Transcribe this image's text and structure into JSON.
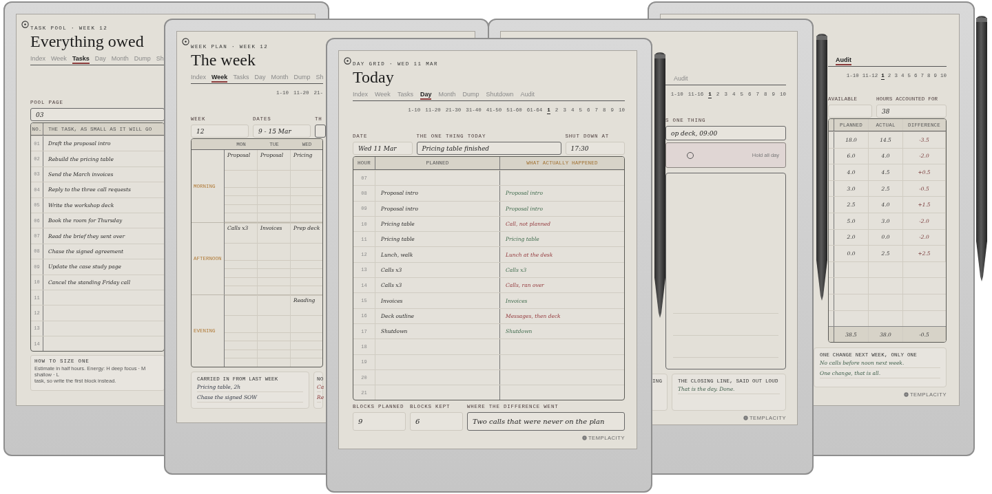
{
  "devices": [
    {
      "kind": "tasks",
      "eyebrow": "TASK POOL · WEEK 12",
      "title": "Everything owed",
      "tabs": [
        {
          "label": "Index",
          "selected": false
        },
        {
          "label": "Week",
          "selected": false
        },
        {
          "label": "Tasks",
          "selected": true
        },
        {
          "label": "Day",
          "selected": false
        },
        {
          "label": "Month",
          "selected": false
        },
        {
          "label": "Dump",
          "selected": false
        },
        {
          "label": "Sh",
          "selected": false
        }
      ],
      "fields": [
        {
          "label": "POOL PAGE",
          "value": "03",
          "highlighted": true
        }
      ],
      "columns": [
        "NO.",
        "THE TASK, AS SMALL AS IT WILL GO"
      ],
      "rows": [
        {
          "no": "01",
          "task": "Draft the proposal intro"
        },
        {
          "no": "02",
          "task": "Rebuild the pricing table"
        },
        {
          "no": "03",
          "task": "Send the March invoices"
        },
        {
          "no": "04",
          "task": "Reply to the three call requests"
        },
        {
          "no": "05",
          "task": "Write the workshop deck"
        },
        {
          "no": "06",
          "task": "Book the room for Thursday"
        },
        {
          "no": "07",
          "task": "Read the brief they sent over"
        },
        {
          "no": "08",
          "task": "Chase the signed agreement"
        },
        {
          "no": "09",
          "task": "Update the case study page"
        },
        {
          "no": "10",
          "task": "Cancel the standing Friday call"
        },
        {
          "no": "11"
        },
        {
          "no": "12"
        },
        {
          "no": "13"
        },
        {
          "no": "14"
        }
      ],
      "note": {
        "title": "HOW TO SIZE ONE",
        "lines": [
          "Estimate in half hours. Energy: H deep focus · M shallow · L",
          "task, so write the first block instead."
        ]
      }
    },
    {
      "kind": "week",
      "eyebrow": "WEEK PLAN · WEEK 12",
      "title": "The week",
      "tabs": [
        {
          "label": "Index",
          "selected": false
        },
        {
          "label": "Week",
          "selected": true
        },
        {
          "label": "Tasks",
          "selected": false
        },
        {
          "label": "Day",
          "selected": false
        },
        {
          "label": "Month",
          "selected": false
        },
        {
          "label": "Dump",
          "selected": false
        },
        {
          "label": "Sh",
          "selected": false
        }
      ],
      "pager": [
        {
          "label": "1-10",
          "selected": false
        },
        {
          "label": "11-20",
          "selected": false
        },
        {
          "label": "21-",
          "selected": false
        }
      ],
      "fields": [
        {
          "label": "WEEK",
          "value": "12",
          "highlighted": false
        },
        {
          "label": "DATES",
          "value": "9 - 15 Mar",
          "highlighted": false
        },
        {
          "label": "TH",
          "highlighted": true
        }
      ],
      "sections": [
        "MORNING",
        "AFTERNOON",
        "EVENING"
      ],
      "columns": [
        {
          "label": "MON",
          "entries": [
            "Proposal",
            "Calls x3"
          ]
        },
        {
          "label": "TUE",
          "entries": [
            "Proposal",
            "Invoices"
          ]
        },
        {
          "label": "WED",
          "entries": [
            "Pricing",
            "Prep deck",
            "Reading"
          ]
        }
      ],
      "boxes": [
        {
          "title": "CARRIED IN FROM LAST WEEK",
          "kind": "dark",
          "lines": [
            "Pricing table, 2h",
            "Chase the signed SOW"
          ]
        },
        {
          "title": "NO",
          "kind": "red",
          "lines": [
            "Ca",
            "Re"
          ]
        }
      ]
    },
    {
      "kind": "day",
      "eyebrow": "DAY GRID · WED 11 MAR",
      "title": "Today",
      "tabs": [
        {
          "label": "Index",
          "selected": false
        },
        {
          "label": "Week",
          "selected": false
        },
        {
          "label": "Tasks",
          "selected": false
        },
        {
          "label": "Day",
          "selected": true
        },
        {
          "label": "Month",
          "selected": false
        },
        {
          "label": "Dump",
          "selected": false
        },
        {
          "label": "Shutdown",
          "selected": false
        },
        {
          "label": "Audit",
          "selected": false
        }
      ],
      "pager": [
        {
          "label": "1-10",
          "selected": false
        },
        {
          "label": "11-20",
          "selected": false
        },
        {
          "label": "21-30",
          "selected": false
        },
        {
          "label": "31-40",
          "selected": false
        },
        {
          "label": "41-50",
          "selected": false
        },
        {
          "label": "51-60",
          "selected": false
        },
        {
          "label": "61-64",
          "selected": false
        },
        {
          "label": "1",
          "selected": true
        },
        {
          "label": "2",
          "selected": false
        },
        {
          "label": "3",
          "selected": false
        },
        {
          "label": "4",
          "selected": false
        },
        {
          "label": "5",
          "selected": false
        },
        {
          "label": "6",
          "selected": false
        },
        {
          "label": "7",
          "selected": false
        },
        {
          "label": "8",
          "selected": false
        },
        {
          "label": "9",
          "selected": false
        },
        {
          "label": "10",
          "selected": false
        }
      ],
      "fields": [
        {
          "label": "DATE",
          "value": "Wed 11 Mar",
          "highlighted": false
        },
        {
          "label": "THE ONE THING TODAY",
          "value": "Pricing table finished",
          "highlighted": true
        },
        {
          "label": "SHUT DOWN AT",
          "value": "17:30",
          "highlighted": false
        }
      ],
      "columns": [
        "HOUR",
        "PLANNED",
        "WHAT ACTUALLY HAPPENED"
      ],
      "rows": [
        {
          "hour": "07"
        },
        {
          "hour": "08",
          "planned": "Proposal intro",
          "actual": "Proposal intro",
          "kept": true
        },
        {
          "hour": "09",
          "planned": "Proposal intro",
          "actual": "Proposal intro",
          "kept": true
        },
        {
          "hour": "10",
          "planned": "Pricing table",
          "actual": "Call, not planned",
          "kept": false
        },
        {
          "hour": "11",
          "planned": "Pricing table",
          "actual": "Pricing table",
          "kept": true
        },
        {
          "hour": "12",
          "planned": "Lunch, walk",
          "actual": "Lunch at the desk",
          "kept": false
        },
        {
          "hour": "13",
          "planned": "Calls x3",
          "actual": "Calls x3",
          "kept": true
        },
        {
          "hour": "14",
          "planned": "Calls x3",
          "actual": "Calls, ran over",
          "kept": false
        },
        {
          "hour": "15",
          "planned": "Invoices",
          "actual": "Invoices",
          "kept": true
        },
        {
          "hour": "16",
          "planned": "Deck outline",
          "actual": "Messages, then deck",
          "kept": false
        },
        {
          "hour": "17",
          "planned": "Shutdown",
          "actual": "Shutdown",
          "kept": true
        },
        {
          "hour": "18"
        },
        {
          "hour": "19"
        },
        {
          "hour": "20"
        },
        {
          "hour": "21"
        }
      ],
      "summary": [
        {
          "label": "BLOCKS PLANNED",
          "value": "9",
          "highlighted": false
        },
        {
          "label": "BLOCKS KEPT",
          "value": "6",
          "highlighted": false
        },
        {
          "label": "WHERE THE DIFFERENCE WENT",
          "value": "Two calls that were never on the plan",
          "highlighted": true
        }
      ],
      "logo": "TEMPLACITY"
    },
    {
      "kind": "shutdown",
      "tabs": [
        {
          "label": "Audit",
          "selected": false
        }
      ],
      "pager": [
        {
          "label": "1-10",
          "selected": false
        },
        {
          "label": "11-16",
          "selected": false
        },
        {
          "label": "1",
          "selected": true
        },
        {
          "label": "2",
          "selected": false
        },
        {
          "label": "3",
          "selected": false
        },
        {
          "label": "4",
          "selected": false
        },
        {
          "label": "5",
          "selected": false
        },
        {
          "label": "6",
          "selected": false
        },
        {
          "label": "7",
          "selected": false
        },
        {
          "label": "8",
          "selected": false
        },
        {
          "label": "9",
          "selected": false
        },
        {
          "label": "10",
          "selected": false
        }
      ],
      "fields": [
        {
          "label": "S ONE THING",
          "value": "op deck, 09:00",
          "highlighted": true
        }
      ],
      "hold": {
        "label": "Hold all day",
        "checked": false
      },
      "boxes": [
        {
          "title": "ING"
        },
        {
          "title": "THE CLOSING LINE, SAID OUT LOUD",
          "kind": "green",
          "lines": [
            "That is the day. Done."
          ]
        }
      ],
      "logo": "TEMPLACITY"
    },
    {
      "kind": "audit",
      "tabs": [
        {
          "label": "Audit",
          "selected": true
        }
      ],
      "pager": [
        {
          "label": "1-10",
          "selected": false
        },
        {
          "label": "11-12",
          "selected": false
        },
        {
          "label": "1",
          "selected": true
        },
        {
          "label": "2",
          "selected": false
        },
        {
          "label": "3",
          "selected": false
        },
        {
          "label": "4",
          "selected": false
        },
        {
          "label": "5",
          "selected": false
        },
        {
          "label": "6",
          "selected": false
        },
        {
          "label": "7",
          "selected": false
        },
        {
          "label": "8",
          "selected": false
        },
        {
          "label": "9",
          "selected": false
        },
        {
          "label": "10",
          "selected": false
        }
      ],
      "fields": [
        {
          "label": "AVAILABLE",
          "highlighted": false
        },
        {
          "label": "HOURS ACCOUNTED FOR",
          "value": "38",
          "highlighted": false
        }
      ],
      "columns": [
        "PLANNED",
        "ACTUAL",
        "DIFFERENCE"
      ],
      "rows": [
        {
          "planned": "18.0",
          "actual": "14.5",
          "difference": "-3.5"
        },
        {
          "planned": "6.0",
          "actual": "4.0",
          "difference": "-2.0"
        },
        {
          "planned": "4.0",
          "actual": "4.5",
          "difference": "+0.5"
        },
        {
          "planned": "3.0",
          "actual": "2.5",
          "difference": "-0.5"
        },
        {
          "planned": "2.5",
          "actual": "4.0",
          "difference": "+1.5"
        },
        {
          "planned": "5.0",
          "actual": "3.0",
          "difference": "-2.0"
        },
        {
          "planned": "2.0",
          "actual": "0.0",
          "difference": "-2.0"
        },
        {
          "planned": "0.0",
          "actual": "2.5",
          "difference": "+2.5"
        }
      ],
      "total": {
        "planned": "38.5",
        "actual": "38.0",
        "difference": "-0.5"
      },
      "boxes": [
        {
          "title": "ONE CHANGE NEXT WEEK, ONLY ONE",
          "kind": "green",
          "lines": [
            "No calls before noon next week.",
            "One change, that is all."
          ]
        }
      ],
      "logo": "TEMPLACITY"
    }
  ]
}
